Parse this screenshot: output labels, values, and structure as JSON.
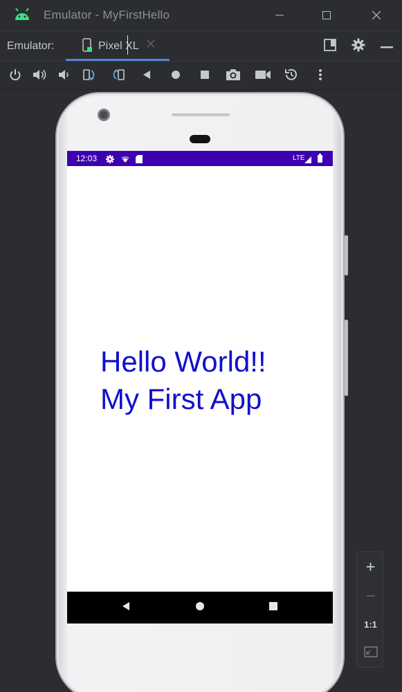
{
  "window": {
    "title": "Emulator - MyFirstHello",
    "app_icon": "android-icon",
    "controls": [
      "minimize-icon",
      "maximize-icon",
      "close-icon"
    ]
  },
  "tabbar": {
    "label": "Emulator:",
    "tab": {
      "label": "Pixel XL",
      "icon": "device-icon",
      "close_icon": "close-tab-icon"
    },
    "tools": [
      "layout-icon",
      "gear-icon",
      "minimize-panel-icon"
    ]
  },
  "toolbar": {
    "tools": [
      "power-icon",
      "volume-up-icon",
      "volume-down-icon",
      "rotate-left-icon",
      "rotate-right-icon",
      "back-icon",
      "home-icon",
      "overview-icon",
      "screenshot-icon",
      "record-icon",
      "snapshot-icon",
      "more-icon"
    ]
  },
  "device": {
    "statusbar": {
      "time": "12:03",
      "network": "LTE",
      "color": "#3d00b0"
    },
    "app": {
      "line1": "Hello World!!",
      "line2": "My First App",
      "text_color": "#1010cc"
    },
    "navbar": [
      "nav-back-icon",
      "nav-home-icon",
      "nav-recents-icon"
    ]
  },
  "zoom": {
    "zoom_in": "+",
    "zoom_out": "−",
    "actual_size": "1:1",
    "fit_icon": "fit-screen-icon"
  }
}
